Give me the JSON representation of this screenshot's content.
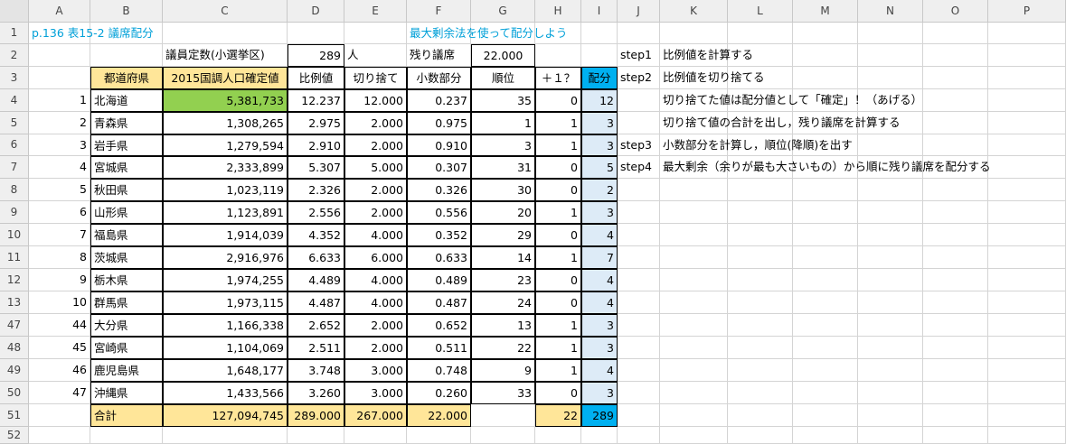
{
  "columns": [
    "A",
    "B",
    "C",
    "D",
    "E",
    "F",
    "G",
    "H",
    "I",
    "J",
    "K",
    "L",
    "M",
    "N",
    "O",
    "P"
  ],
  "row_numbers": [
    "1",
    "2",
    "3",
    "4",
    "5",
    "6",
    "7",
    "8",
    "9",
    "10",
    "11",
    "12",
    "13",
    "47",
    "48",
    "49",
    "50",
    "51",
    "52"
  ],
  "title": "p.136 表15-2 議席配分",
  "subtitle": "最大剰余法を使って配分しよう",
  "seats_label": "議員定数(小選挙区)",
  "seats_value": "289",
  "seats_unit": "人",
  "remaining_label": "残り議席",
  "remaining_value": "22.000",
  "headers": {
    "pref": "都道府県",
    "pop": "2015国調人口確定値",
    "ratio": "比例値",
    "floor": "切り捨て",
    "frac": "小数部分",
    "rank": "順位",
    "plus": "＋１？",
    "alloc": "配分"
  },
  "rows": [
    {
      "no": "1",
      "pref": "北海道",
      "pop": "5,381,733",
      "ratio": "12.237",
      "floor": "12.000",
      "frac": "0.237",
      "rank": "35",
      "plus": "0",
      "alloc": "12"
    },
    {
      "no": "2",
      "pref": "青森県",
      "pop": "1,308,265",
      "ratio": "2.975",
      "floor": "2.000",
      "frac": "0.975",
      "rank": "1",
      "plus": "1",
      "alloc": "3"
    },
    {
      "no": "3",
      "pref": "岩手県",
      "pop": "1,279,594",
      "ratio": "2.910",
      "floor": "2.000",
      "frac": "0.910",
      "rank": "3",
      "plus": "1",
      "alloc": "3"
    },
    {
      "no": "4",
      "pref": "宮城県",
      "pop": "2,333,899",
      "ratio": "5.307",
      "floor": "5.000",
      "frac": "0.307",
      "rank": "31",
      "plus": "0",
      "alloc": "5"
    },
    {
      "no": "5",
      "pref": "秋田県",
      "pop": "1,023,119",
      "ratio": "2.326",
      "floor": "2.000",
      "frac": "0.326",
      "rank": "30",
      "plus": "0",
      "alloc": "2"
    },
    {
      "no": "6",
      "pref": "山形県",
      "pop": "1,123,891",
      "ratio": "2.556",
      "floor": "2.000",
      "frac": "0.556",
      "rank": "20",
      "plus": "1",
      "alloc": "3"
    },
    {
      "no": "7",
      "pref": "福島県",
      "pop": "1,914,039",
      "ratio": "4.352",
      "floor": "4.000",
      "frac": "0.352",
      "rank": "29",
      "plus": "0",
      "alloc": "4"
    },
    {
      "no": "8",
      "pref": "茨城県",
      "pop": "2,916,976",
      "ratio": "6.633",
      "floor": "6.000",
      "frac": "0.633",
      "rank": "14",
      "plus": "1",
      "alloc": "7"
    },
    {
      "no": "9",
      "pref": "栃木県",
      "pop": "1,974,255",
      "ratio": "4.489",
      "floor": "4.000",
      "frac": "0.489",
      "rank": "23",
      "plus": "0",
      "alloc": "4"
    },
    {
      "no": "10",
      "pref": "群馬県",
      "pop": "1,973,115",
      "ratio": "4.487",
      "floor": "4.000",
      "frac": "0.487",
      "rank": "24",
      "plus": "0",
      "alloc": "4"
    },
    {
      "no": "44",
      "pref": "大分県",
      "pop": "1,166,338",
      "ratio": "2.652",
      "floor": "2.000",
      "frac": "0.652",
      "rank": "13",
      "plus": "1",
      "alloc": "3"
    },
    {
      "no": "45",
      "pref": "宮崎県",
      "pop": "1,104,069",
      "ratio": "2.511",
      "floor": "2.000",
      "frac": "0.511",
      "rank": "22",
      "plus": "1",
      "alloc": "3"
    },
    {
      "no": "46",
      "pref": "鹿児島県",
      "pop": "1,648,177",
      "ratio": "3.748",
      "floor": "3.000",
      "frac": "0.748",
      "rank": "9",
      "plus": "1",
      "alloc": "4"
    },
    {
      "no": "47",
      "pref": "沖縄県",
      "pop": "1,433,566",
      "ratio": "3.260",
      "floor": "3.000",
      "frac": "0.260",
      "rank": "33",
      "plus": "0",
      "alloc": "3"
    }
  ],
  "totals": {
    "label": "合計",
    "pop": "127,094,745",
    "ratio": "289.000",
    "floor": "267.000",
    "frac": "22.000",
    "plus": "22",
    "alloc": "289"
  },
  "steps": [
    {
      "tag": "step1",
      "text": "比例値を計算する"
    },
    {
      "tag": "step2",
      "text": "比例値を切り捨てる"
    },
    {
      "tag": "",
      "text": "切り捨てた値は配分値として「確定」！（あげる）"
    },
    {
      "tag": "",
      "text": "切り捨て値の合計を出し，残り議席を計算する"
    },
    {
      "tag": "step3",
      "text": "小数部分を計算し，順位(降順)を出す"
    },
    {
      "tag": "step4",
      "text": "最大剰余（余りが最も大さいもの）から順に残り議席を配分する"
    }
  ]
}
